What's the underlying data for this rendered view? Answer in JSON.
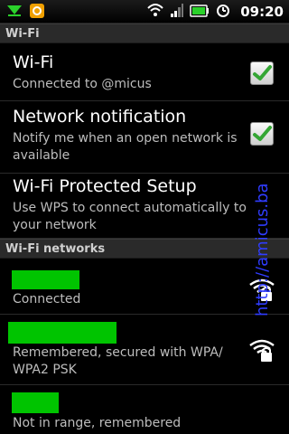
{
  "status_bar": {
    "time": "09:20",
    "icons": [
      "notification-arrow-icon",
      "market-icon",
      "wifi-icon",
      "signal-icon",
      "battery-icon",
      "alarm-icon"
    ]
  },
  "sections": {
    "wifi_header": "Wi-Fi",
    "networks_header": "Wi-Fi networks"
  },
  "prefs": {
    "wifi": {
      "title": "Wi-Fi",
      "summary": "Connected to @micus",
      "checked": true
    },
    "network_notification": {
      "title": "Network notification",
      "summary": "Notify me when an open network is available",
      "checked": true
    },
    "wps": {
      "title": "Wi-Fi Protected Setup",
      "summary": "Use WPS to connect automatically to your network"
    }
  },
  "networks": [
    {
      "status": "Connected",
      "icon": "wifi-lock-icon"
    },
    {
      "status": "Remembered, secured with WPA/ WPA2 PSK",
      "icon": "wifi-lock-icon"
    },
    {
      "status": "Not in range, remembered"
    }
  ],
  "watermark": "http://amicus.ba",
  "colors": {
    "accent_green": "#00c400",
    "check_green": "#34a634",
    "watermark_blue": "#2f3cff"
  }
}
